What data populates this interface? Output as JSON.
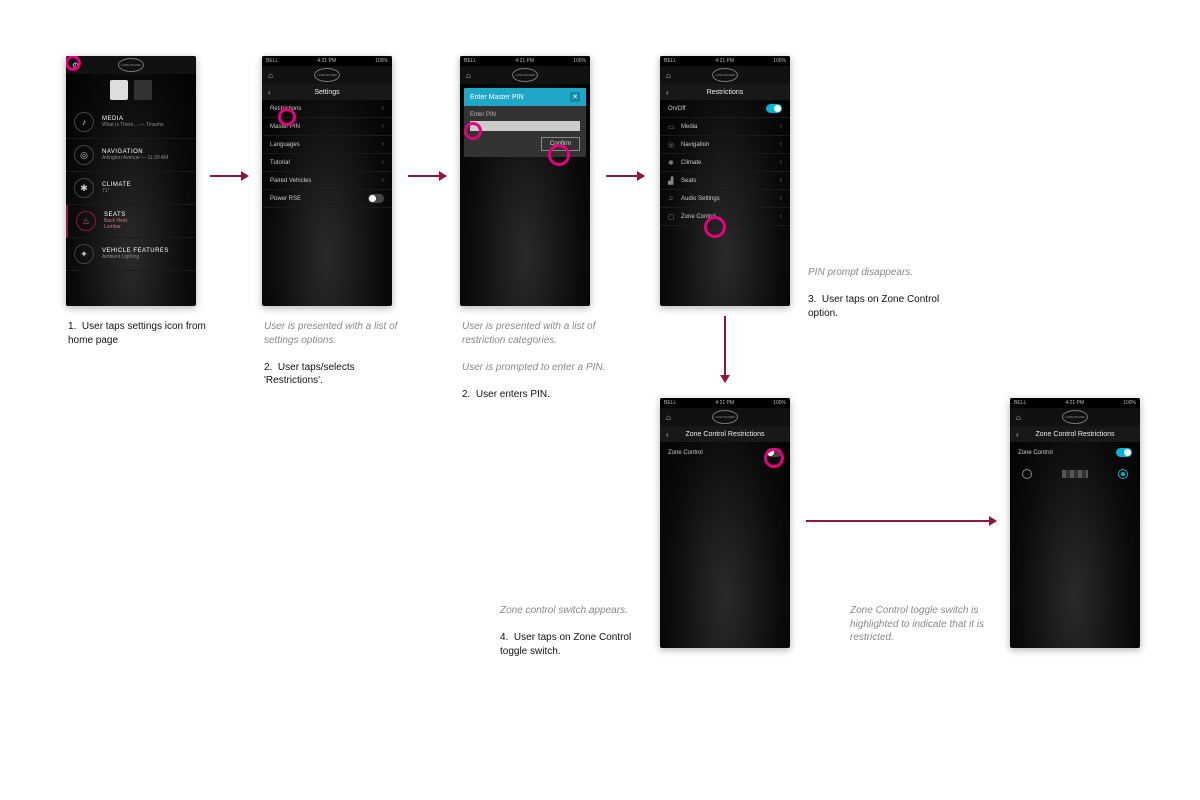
{
  "statusbar": {
    "carrier": "BELL",
    "time": "4:21 PM",
    "battery": "100%"
  },
  "brand": "LAND ROVER",
  "screens": {
    "home": {
      "items": [
        {
          "title": "MEDIA",
          "sub": "What Is There… — Tinashe"
        },
        {
          "title": "NAVIGATION",
          "sub": "Arlington Avenue — 11:20 AM"
        },
        {
          "title": "CLIMATE",
          "sub": "71°"
        },
        {
          "title": "SEATS",
          "sub1": "Back Heat",
          "sub2": "Lumbar"
        },
        {
          "title": "VEHICLE FEATURES",
          "sub": "Ambient Lighting"
        }
      ]
    },
    "settings": {
      "title": "Settings",
      "rows": [
        "Restrictions",
        "Master PIN",
        "Languages",
        "Tutorial",
        "Paired Vehicles",
        "Power RSE"
      ]
    },
    "pin": {
      "dialog_title": "Enter Master PIN",
      "field_label": "Enter PIN",
      "confirm": "Confirm"
    },
    "restrictions": {
      "title": "Restrictions",
      "onoff": "On/Off",
      "rows": [
        "Media",
        "Navigation",
        "Climate",
        "Seats",
        "Audio Settings",
        "Zone Control"
      ]
    },
    "zone": {
      "title": "Zone Control Restrictions",
      "label": "Zone Control"
    }
  },
  "captions": {
    "c1": "User taps settings icon from home page",
    "c2_em": "User is presented with a list of settings options.",
    "c2": "User taps/selects 'Restrictions'.",
    "c3_em1": "User is presented with a list of restriction categories.",
    "c3_em2": "User is prompted to enter a PIN.",
    "c3": "User enters PIN.",
    "c4_em": "PIN prompt disappears.",
    "c4": "User taps on Zone Control option.",
    "c5_em": "Zone control switch appears.",
    "c5": "User taps on Zone Control toggle switch.",
    "c6_em": "Zone Control toggle switch is highlighted to indicate that it is restricted."
  }
}
